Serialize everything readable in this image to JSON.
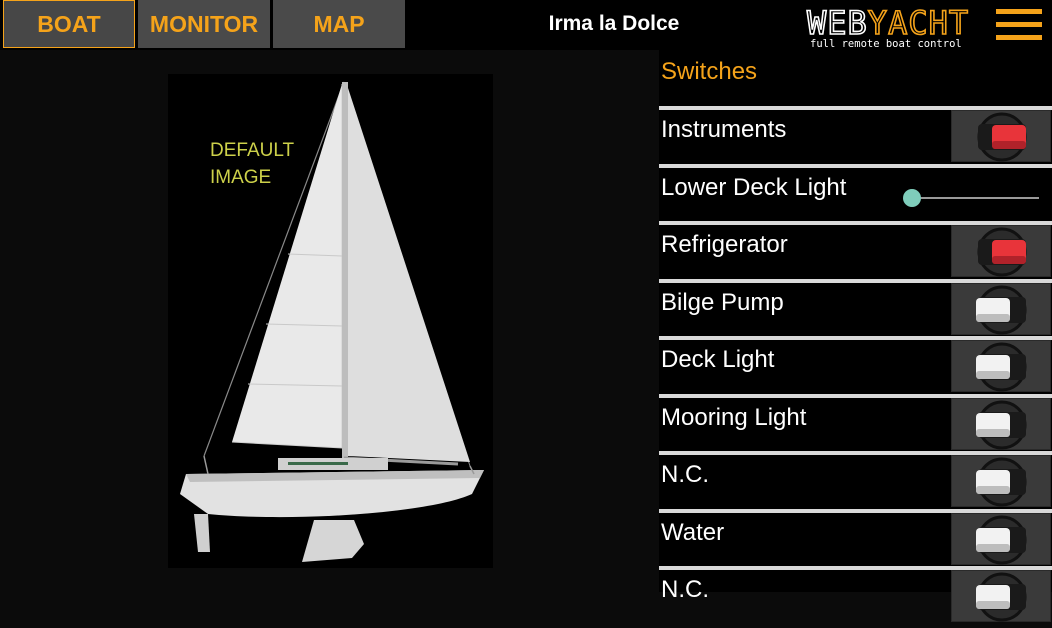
{
  "nav": {
    "tabs": [
      {
        "label": "BOAT",
        "active": true
      },
      {
        "label": "MONITOR",
        "active": false
      },
      {
        "label": "MAP",
        "active": false
      }
    ]
  },
  "header": {
    "boat_name": "Irma la Dolce",
    "logo_text": "WEBYACHT",
    "logo_tagline": "full remote boat control",
    "menu_icon": "hamburger-menu-icon"
  },
  "boat_image": {
    "caption_line1": "DEFAULT",
    "caption_line2": "IMAGE"
  },
  "switches": {
    "title": "Switches",
    "items": [
      {
        "label": "Instruments",
        "type": "toggle",
        "state": "on"
      },
      {
        "label": "Lower Deck Light",
        "type": "slider",
        "level": 0
      },
      {
        "label": "Refrigerator",
        "type": "toggle",
        "state": "on"
      },
      {
        "label": "Bilge Pump",
        "type": "toggle",
        "state": "off"
      },
      {
        "label": "Deck Light",
        "type": "toggle",
        "state": "off"
      },
      {
        "label": "Mooring Light",
        "type": "toggle",
        "state": "off"
      },
      {
        "label": "N.C.",
        "type": "toggle",
        "state": "off"
      },
      {
        "label": "Water",
        "type": "toggle",
        "state": "off"
      },
      {
        "label": "N.C.",
        "type": "toggle",
        "state": "off"
      }
    ]
  },
  "colors": {
    "accent": "#f5a31a",
    "switch_on": "#e8343a",
    "switch_off": "#f2f2f2",
    "slider_thumb": "#7fcdbb"
  }
}
